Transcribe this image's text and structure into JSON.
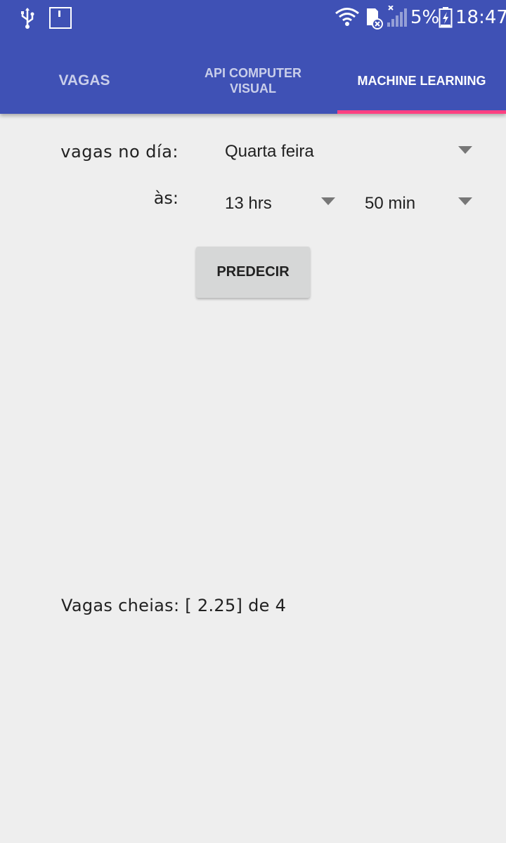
{
  "status_bar": {
    "battery_percent": "5%",
    "time": "18:47",
    "icons": [
      "usb-icon",
      "screenshot-icon",
      "wifi-icon",
      "sd-card-icon",
      "signal-icon",
      "battery-charging-icon"
    ]
  },
  "tabs": [
    {
      "label": "VAGAS",
      "selected": false
    },
    {
      "label": "API COMPUTER VISUAL",
      "selected": false
    },
    {
      "label": "MACHINE LEARNING",
      "selected": true
    }
  ],
  "colors": {
    "app_bar": "#3f51b5",
    "tab_indicator": "#ff4081",
    "background": "#eeeeee",
    "button": "#d6d7d7"
  },
  "form": {
    "day_label": "vagas no día:",
    "day_value": "Quarta feira",
    "time_label": "às:",
    "hour_value": "13 hrs",
    "minute_value": "50 min"
  },
  "predict_button": "PREDECIR",
  "result_text": "Vagas cheias: [ 2.25] de 4"
}
